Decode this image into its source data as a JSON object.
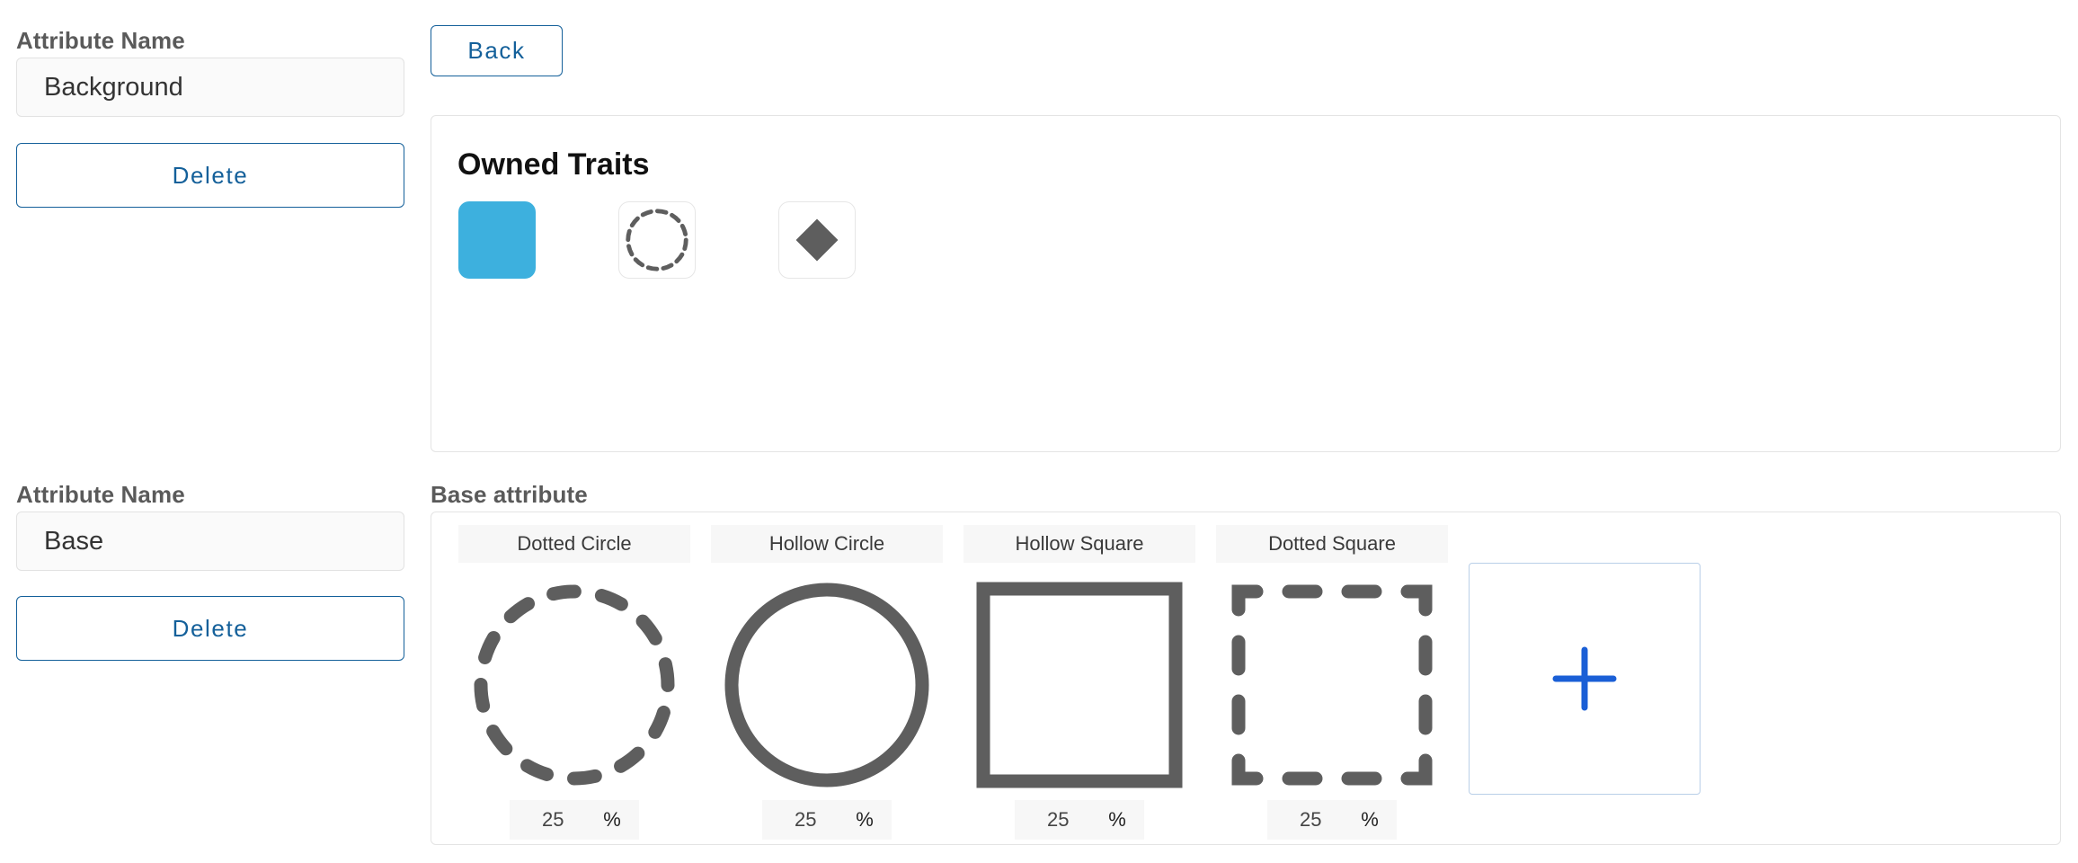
{
  "section1": {
    "label": "Attribute Name",
    "value": "Background",
    "delete_label": "Delete"
  },
  "back_label": "Back",
  "owned": {
    "title": "Owned Traits",
    "traits": [
      {
        "icon": "blue-square-icon",
        "color": "#3db0de"
      },
      {
        "icon": "dotted-circle-icon"
      },
      {
        "icon": "diamond-icon"
      }
    ]
  },
  "section2": {
    "label": "Attribute Name",
    "value": "Base",
    "delete_label": "Delete",
    "base_label": "Base attribute",
    "traits": [
      {
        "name": "Dotted Circle",
        "percent": "25",
        "unit": "%",
        "icon": "dotted-circle-icon"
      },
      {
        "name": "Hollow Circle",
        "percent": "25",
        "unit": "%",
        "icon": "hollow-circle-icon"
      },
      {
        "name": "Hollow Square",
        "percent": "25",
        "unit": "%",
        "icon": "hollow-square-icon"
      },
      {
        "name": "Dotted Square",
        "percent": "25",
        "unit": "%",
        "icon": "dotted-square-icon"
      }
    ],
    "add_icon": "plus-icon"
  },
  "colors": {
    "accent": "#14609a",
    "shape_gray": "#5e5e5e",
    "plus_blue": "#1a5fd6",
    "trait_blue": "#3db0de"
  }
}
